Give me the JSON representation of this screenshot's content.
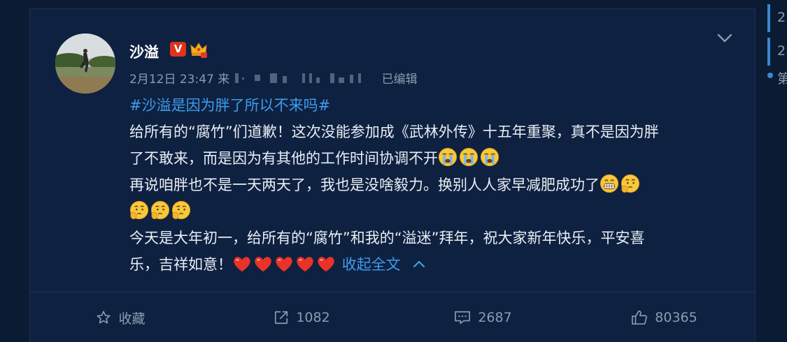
{
  "post": {
    "username": "沙溢",
    "verified_badge": "V",
    "timestamp": "2月12日 23:47",
    "source_prefix": "来",
    "edited": "已编辑",
    "hashtag": "#沙溢是因为胖了所以不来吗#",
    "line1": "给所有的“腐竹”们道歉！这次没能参加成《武林外传》十五年重聚，真不是因为胖",
    "line2": "了不敢来，而是因为有其他的工作时间协调不开",
    "line3": "再说咱胖也不是一天两天了，我也是没啥毅力。换别人人家早减肥成功了",
    "line5": "今天是大年初一，给所有的“腐竹”和我的“溢迷”拜年，祝大家新年快乐，平安喜",
    "line6": "乐，吉祥如意！",
    "collapse": "收起全文"
  },
  "actions": {
    "favorite": "收藏",
    "repost": "1082",
    "comment": "2687",
    "like": "80365"
  },
  "sidebar": {
    "items": [
      "2",
      "2",
      "第"
    ]
  },
  "icons": [
    "crown-icon",
    "chevron-down-icon",
    "crying-emoji",
    "grin-emoji",
    "thinking-emoji",
    "heart-emoji",
    "chevron-up-icon",
    "star-icon",
    "share-icon",
    "comment-icon",
    "thumbs-up-icon"
  ],
  "colors": {
    "background": "#0b1b33",
    "card": "#0f2140",
    "link": "#3d9df0",
    "text": "#e9eef5",
    "muted": "#8c9bb1",
    "badge": "#e0331c"
  }
}
